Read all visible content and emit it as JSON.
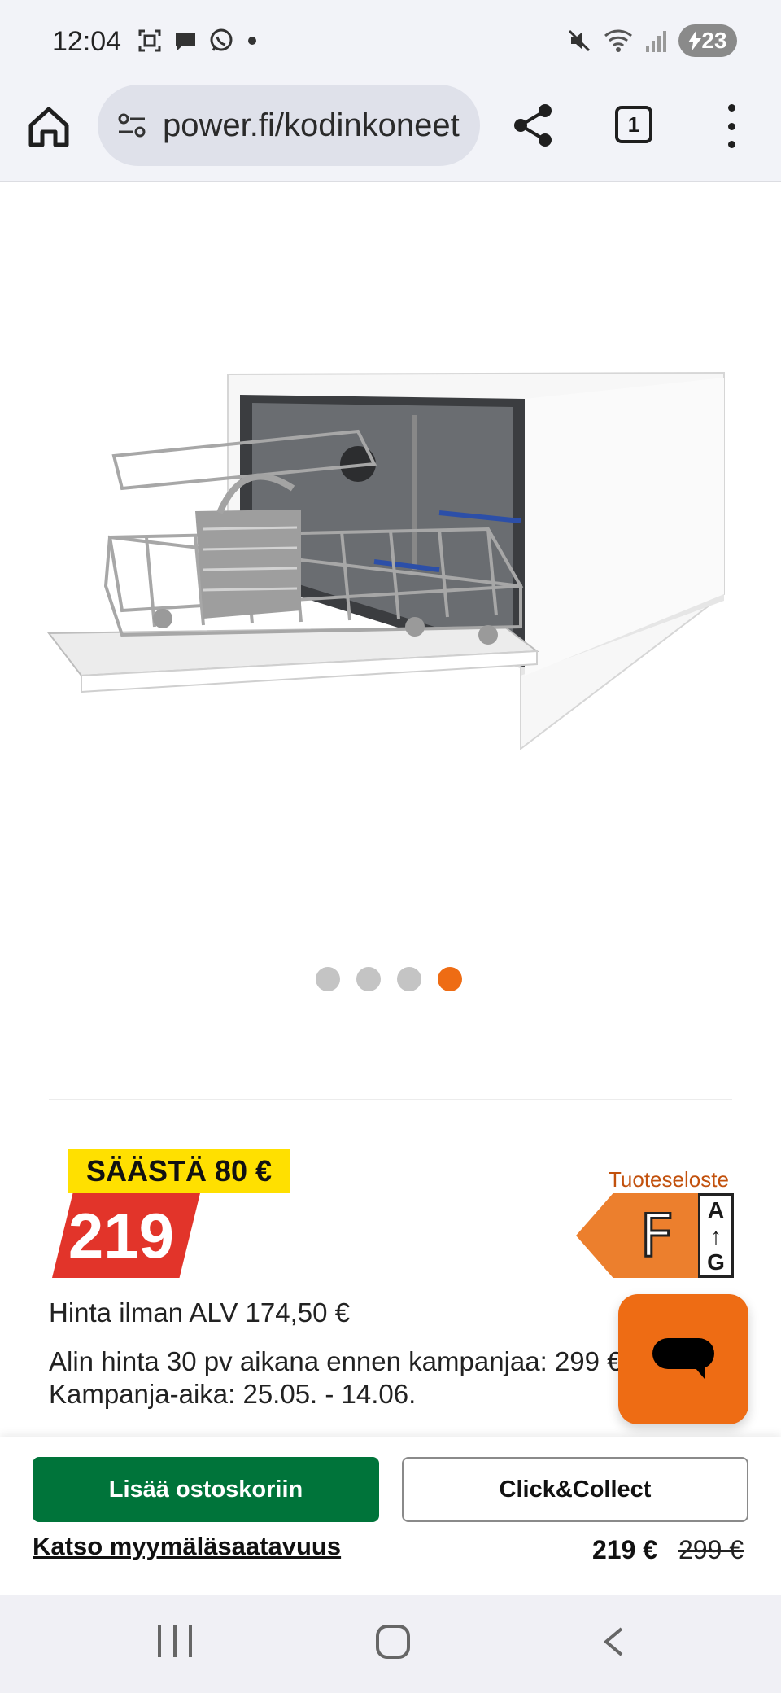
{
  "status_bar": {
    "time": "12:04",
    "left_icons": [
      "screenshot-icon",
      "chat-icon",
      "whatsapp-icon",
      "dot-icon"
    ],
    "right_icons": [
      "mute-icon",
      "wifi-icon",
      "signal-icon"
    ],
    "battery": "23"
  },
  "browser": {
    "url": "power.fi/kodinkoneet",
    "tab_count": "1"
  },
  "product": {
    "image_alt": "dishwasher",
    "carousel_count": 4,
    "carousel_active_index": 3
  },
  "pricing": {
    "save_label": "SÄÄSTÄ 80 €",
    "price": "219",
    "energy_link": "Tuoteseloste",
    "energy_class": "F",
    "energy_scale_top": "A",
    "energy_scale_arrow": "↑",
    "energy_scale_bottom": "G",
    "price_no_vat": "Hinta ilman ALV 174,50 €",
    "lowest_price": "Alin hinta 30 pv aikana ennen kampanjaa: 299 €",
    "campaign_period": "Kampanja-aika: 25.05. - 14.06."
  },
  "sticky": {
    "add_to_cart": "Lisää ostoskoriin",
    "click_collect": "Click&Collect",
    "store_availability": "Katso myymäläsaatavuus",
    "price": "219 €",
    "old_price": "299 €"
  },
  "colors": {
    "accent_orange": "#ee6c14",
    "cart_green": "#00743a",
    "price_red": "#e2342a",
    "save_yellow": "#ffe000"
  }
}
